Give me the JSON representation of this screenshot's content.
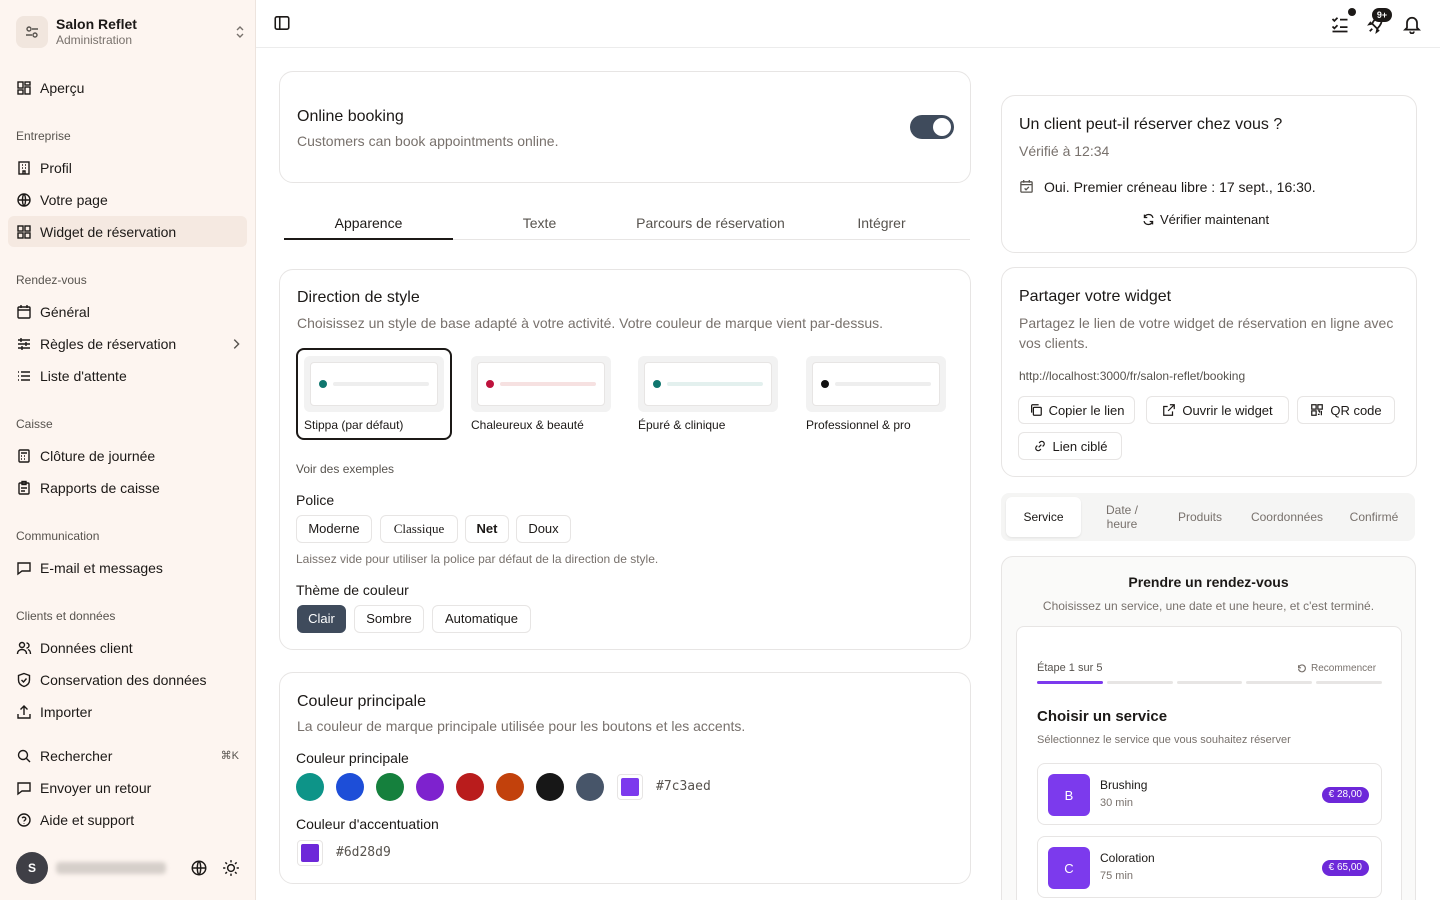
{
  "org": {
    "name": "Salon Reflet",
    "sub": "Administration"
  },
  "nav": {
    "overview": "Aperçu",
    "group_company": "Entreprise",
    "profile": "Profil",
    "your_page": "Votre page",
    "widget": "Widget de réservation",
    "group_appointments": "Rendez-vous",
    "general": "Général",
    "booking_rules": "Règles de réservation",
    "waitlist": "Liste d'attente",
    "group_cash": "Caisse",
    "day_close": "Clôture de journée",
    "cash_reports": "Rapports de caisse",
    "group_comm": "Communication",
    "email": "E-mail et messages",
    "group_clients": "Clients et données",
    "client_data": "Données client",
    "retention": "Conservation des données",
    "import": "Importer",
    "search": "Rechercher",
    "search_shortcut": "⌘K",
    "feedback": "Envoyer un retour",
    "help": "Aide et support"
  },
  "user": {
    "initial": "S"
  },
  "topbar": {
    "badge": "9+"
  },
  "booking_card": {
    "title": "Online booking",
    "desc": "Customers can book appointments online.",
    "enabled": true
  },
  "tabs": [
    "Apparence",
    "Texte",
    "Parcours de réservation",
    "Intégrer"
  ],
  "style": {
    "title": "Direction de style",
    "desc": "Choisissez un style de base adapté à votre activité. Votre couleur de marque vient par-dessus.",
    "options": [
      {
        "label": "Stippa (par défaut)",
        "dot": "#0f766e",
        "bar": "#eeeeee"
      },
      {
        "label": "Chaleureux & beauté",
        "dot": "#be123c",
        "bar": "#f6e1e1"
      },
      {
        "label": "Épuré & clinique",
        "dot": "#0f766e",
        "bar": "#e3f0ee"
      },
      {
        "label": "Professionnel & pro",
        "dot": "#111111",
        "bar": "#eeeeee"
      }
    ],
    "examples": "Voir des exemples",
    "font_label": "Police",
    "fonts": [
      "Moderne",
      "Classique",
      "Net",
      "Doux"
    ],
    "font_hint": "Laissez vide pour utiliser la police par défaut de la direction de style.",
    "theme_label": "Thème de couleur",
    "themes": [
      "Clair",
      "Sombre",
      "Automatique"
    ]
  },
  "color": {
    "title": "Couleur principale",
    "desc": "La couleur de marque principale utilisée pour les boutons et les accents.",
    "primary_label": "Couleur principale",
    "swatches": [
      "#0d9488",
      "#1d4ed8",
      "#15803d",
      "#7e22ce",
      "#b91c1c",
      "#c2410c",
      "#171717",
      "#475569"
    ],
    "primary_value": "#7c3aed",
    "accent_label": "Couleur d'accentuation",
    "accent_value": "#6d28d9"
  },
  "check": {
    "title": "Un client peut-il réserver chez vous ?",
    "verified": "Vérifié à 12:34",
    "result": "Oui. Premier créneau libre : 17 sept., 16:30.",
    "verify_btn": "Vérifier maintenant"
  },
  "share": {
    "title": "Partager votre widget",
    "desc": "Partagez le lien de votre widget de réservation en ligne avec vos clients.",
    "url": "http://localhost:3000/fr/salon-reflet/booking",
    "copy": "Copier le lien",
    "open": "Ouvrir le widget",
    "qr": "QR code",
    "targeted": "Lien ciblé"
  },
  "preview": {
    "steps": [
      "Service",
      "Date / heure",
      "Produits",
      "Coordonnées",
      "Confirmé"
    ],
    "title": "Prendre un rendez-vous",
    "desc": "Choisissez un service, une date et une heure, et c'est terminé.",
    "step_text": "Étape 1 sur 5",
    "restart": "Recommencer",
    "progress": 0.2,
    "choose_title": "Choisir un service",
    "choose_desc": "Sélectionnez le service que vous souhaitez réserver",
    "services": [
      {
        "letter": "B",
        "name": "Brushing",
        "duration": "30 min",
        "price": "€ 28,00"
      },
      {
        "letter": "C",
        "name": "Coloration",
        "duration": "75 min",
        "price": "€ 65,00"
      }
    ]
  }
}
